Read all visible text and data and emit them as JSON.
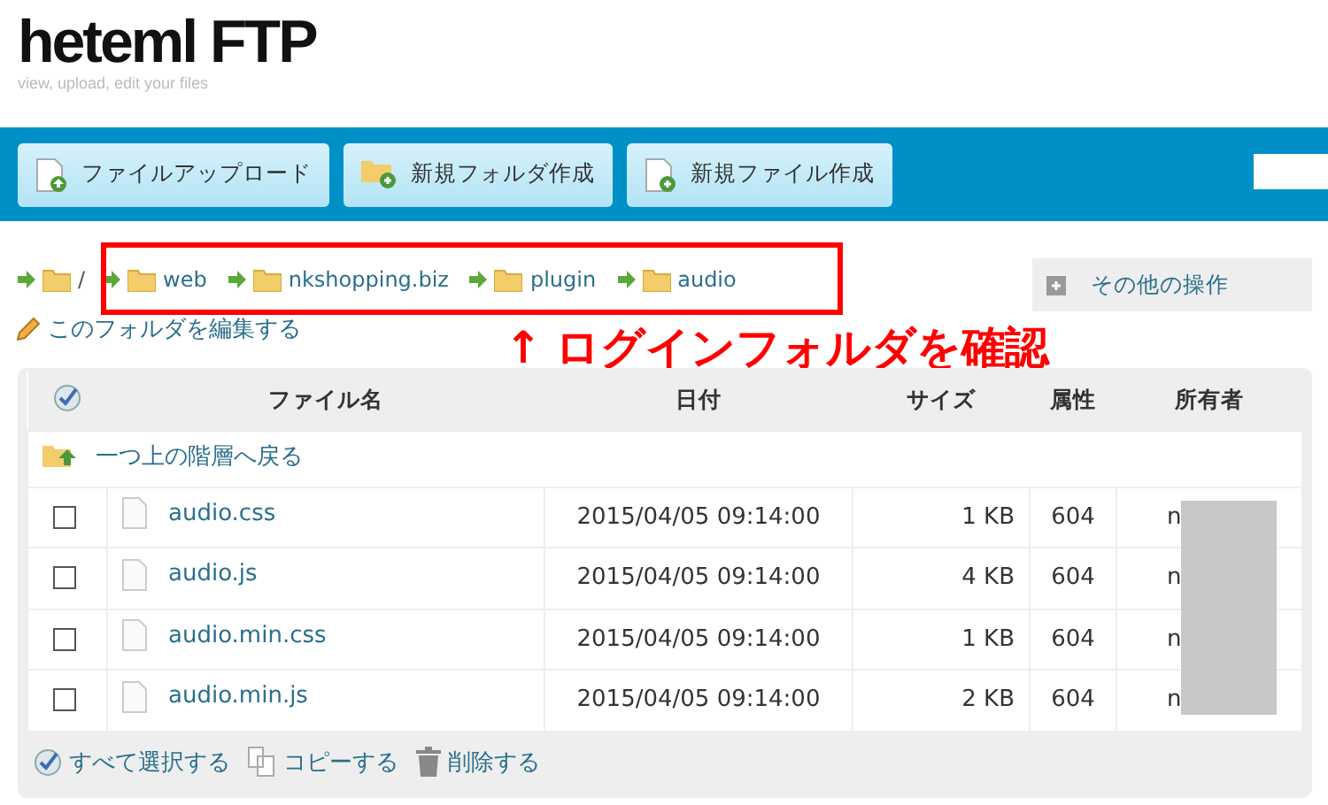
{
  "logo": {
    "title": "heteml FTP",
    "tagline": "view, upload, edit your files"
  },
  "toolbar": {
    "buttons": [
      {
        "label": "ファイルアップロード",
        "kind": "upload"
      },
      {
        "label": "新規フォルダ作成",
        "kind": "folder"
      },
      {
        "label": "新規ファイル作成",
        "kind": "file"
      }
    ]
  },
  "breadcrumb": {
    "root": "/",
    "items": [
      "web",
      "nkshopping.biz",
      "plugin",
      "audio"
    ]
  },
  "edit_link": "このフォルダを編集する",
  "other_actions": "その他の操作",
  "annotation": {
    "text": "↑ ログインフォルダを確認",
    "color": "#ff0000"
  },
  "table": {
    "columns": [
      "ファイル名",
      "日付",
      "サイズ",
      "属性",
      "所有者"
    ],
    "up_link": "一つ上の階層へ戻る",
    "rows": [
      {
        "name": "audio.css",
        "date": "2015/04/05 09:14:00",
        "size": "1 KB",
        "mode": "604",
        "owner": "n",
        "checked": false
      },
      {
        "name": "audio.js",
        "date": "2015/04/05 09:14:00",
        "size": "4 KB",
        "mode": "604",
        "owner": "n",
        "checked": false
      },
      {
        "name": "audio.min.css",
        "date": "2015/04/05 09:14:00",
        "size": "1 KB",
        "mode": "604",
        "owner": "n",
        "checked": false
      },
      {
        "name": "audio.min.js",
        "date": "2015/04/05 09:14:00",
        "size": "2 KB",
        "mode": "604",
        "owner": "n",
        "checked": false
      }
    ]
  },
  "footer_actions": [
    {
      "label": "すべて選択する",
      "kind": "select"
    },
    {
      "label": "コピーする",
      "kind": "copy"
    },
    {
      "label": "削除する",
      "kind": "delete"
    }
  ]
}
